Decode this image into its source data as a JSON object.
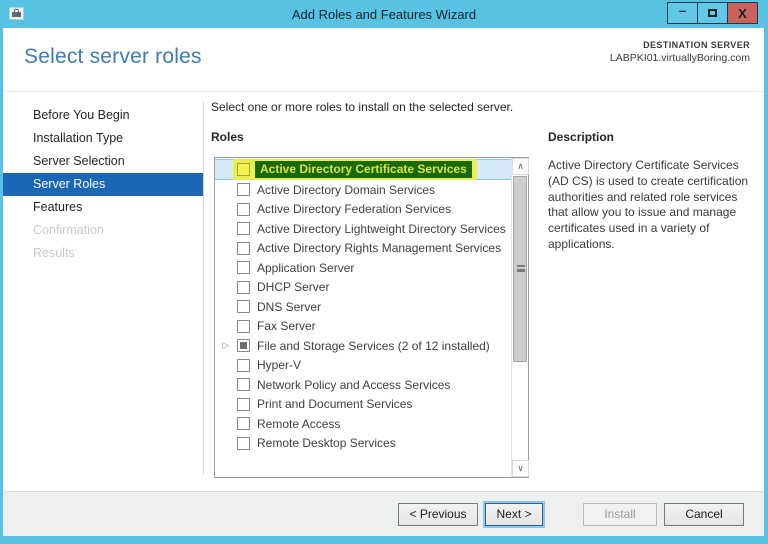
{
  "window": {
    "title": "Add Roles and Features Wizard",
    "controls": {
      "minimize": "–",
      "close": "X"
    }
  },
  "header": {
    "title": "Select server roles",
    "destination_label": "DESTINATION SERVER",
    "destination_server": "LABPKI01.virtuallyBoring.com"
  },
  "sidebar": {
    "items": [
      {
        "label": "Before You Begin",
        "state": "normal"
      },
      {
        "label": "Installation Type",
        "state": "normal"
      },
      {
        "label": "Server Selection",
        "state": "normal"
      },
      {
        "label": "Server Roles",
        "state": "active"
      },
      {
        "label": "Features",
        "state": "normal"
      },
      {
        "label": "Confirmation",
        "state": "disabled"
      },
      {
        "label": "Results",
        "state": "disabled"
      }
    ]
  },
  "main": {
    "instruction": "Select one or more roles to install on the selected server.",
    "roles_label": "Roles",
    "roles": [
      {
        "label": "Active Directory Certificate Services",
        "checked": false,
        "selected": true,
        "highlighted": true
      },
      {
        "label": "Active Directory Domain Services",
        "checked": false
      },
      {
        "label": "Active Directory Federation Services",
        "checked": false
      },
      {
        "label": "Active Directory Lightweight Directory Services",
        "checked": false
      },
      {
        "label": "Active Directory Rights Management Services",
        "checked": false
      },
      {
        "label": "Application Server",
        "checked": false
      },
      {
        "label": "DHCP Server",
        "checked": false
      },
      {
        "label": "DNS Server",
        "checked": false
      },
      {
        "label": "Fax Server",
        "checked": false
      },
      {
        "label": "File and Storage Services (2 of 12 installed)",
        "checked": false,
        "expandable": true,
        "indeterminate": true
      },
      {
        "label": "Hyper-V",
        "checked": false
      },
      {
        "label": "Network Policy and Access Services",
        "checked": false
      },
      {
        "label": "Print and Document Services",
        "checked": false
      },
      {
        "label": "Remote Access",
        "checked": false
      },
      {
        "label": "Remote Desktop Services",
        "checked": false
      }
    ],
    "scrollbar": {
      "up_icon": "∧",
      "down_icon": "∨"
    }
  },
  "description": {
    "title": "Description",
    "text": "Active Directory Certificate Services (AD CS) is used to create certification authorities and related role services that allow you to issue and manage certificates used in a variety of applications."
  },
  "footer": {
    "previous_label": "< Previous",
    "next_label": "Next >",
    "install_label": "Install",
    "cancel_label": "Cancel"
  },
  "colors": {
    "titlebar_blue": "#58c2e2",
    "close_red": "#c9625a",
    "accent_selection_blue": "#1b66b5",
    "heading_blue": "#3d7bb5",
    "row_selected_blue": "#d5ebfa",
    "annotation_yellow": "#e9ef52",
    "annotation_green": "#17690b"
  }
}
